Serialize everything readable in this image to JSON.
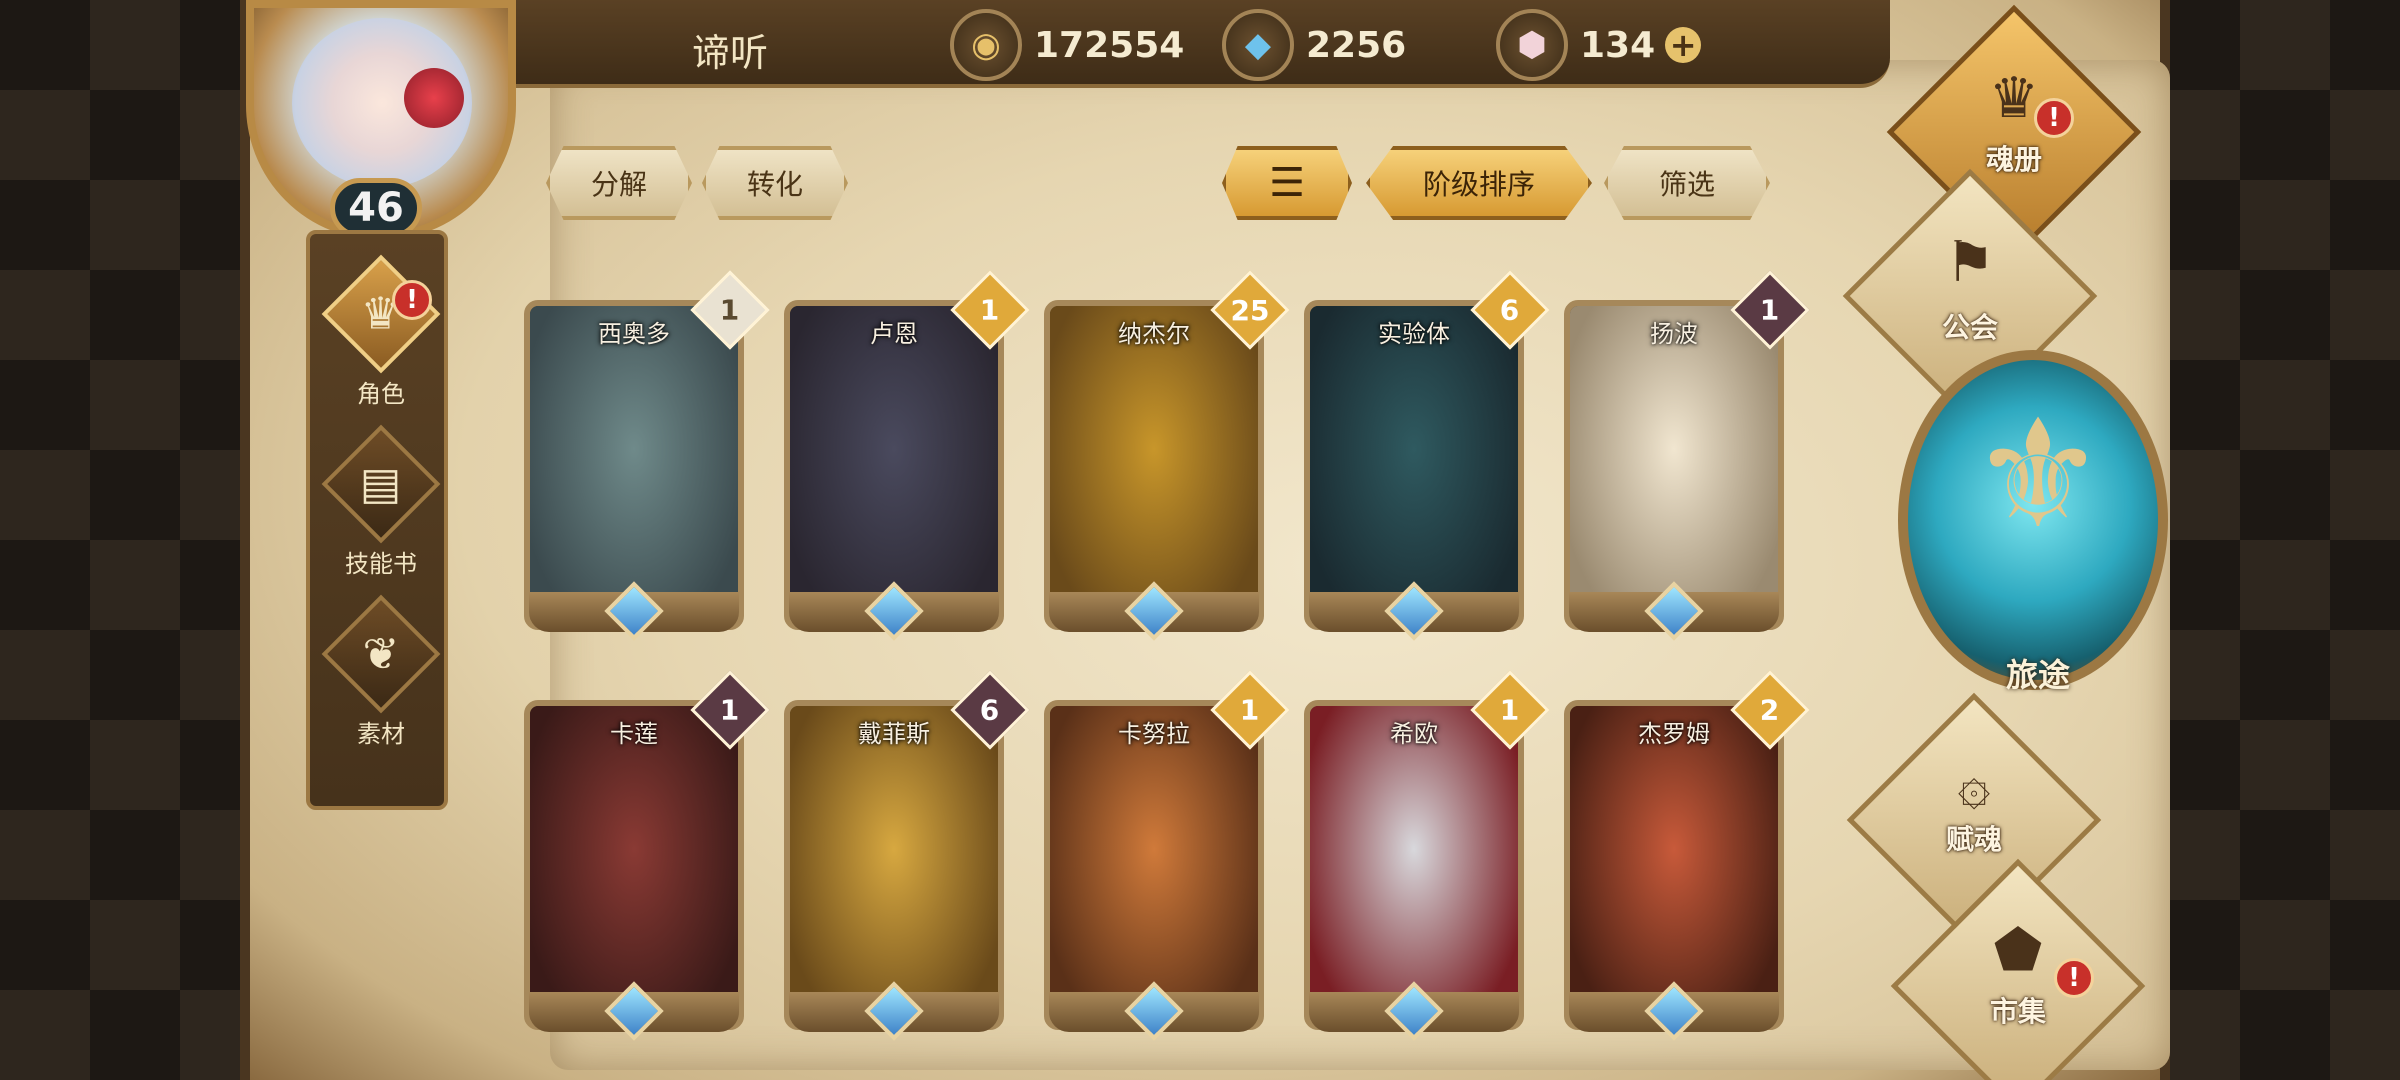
{
  "player": {
    "name": "谛听",
    "level": "46"
  },
  "currencies": [
    {
      "icon": "gold-coin-icon",
      "value": "172554"
    },
    {
      "icon": "blue-crystal-icon",
      "value": "2256"
    },
    {
      "icon": "prism-gem-icon",
      "value": "134"
    }
  ],
  "left_nav": [
    {
      "label": "角色",
      "icon": "character-icon",
      "alert": "!"
    },
    {
      "label": "技能书",
      "icon": "skill-book-icon"
    },
    {
      "label": "素材",
      "icon": "material-icon"
    }
  ],
  "actions": {
    "decompose": "分解",
    "convert": "转化",
    "sort_order": "阶级排序",
    "filter": "筛选",
    "sort_icon": "sort-lines-icon"
  },
  "heroes": [
    {
      "name": "西奥多",
      "count": "1",
      "shard_color": "#e9e2d2"
    },
    {
      "name": "卢恩",
      "count": "1",
      "shard_color": "#e0a93a"
    },
    {
      "name": "纳杰尔",
      "count": "25",
      "shard_color": "#e0a93a"
    },
    {
      "name": "实验体",
      "count": "6",
      "shard_color": "#e0a93a"
    },
    {
      "name": "扬波",
      "count": "1",
      "shard_color": "#5a3a44"
    },
    {
      "name": "卡莲",
      "count": "1",
      "shard_color": "#5a3a44"
    },
    {
      "name": "戴菲斯",
      "count": "6",
      "shard_color": "#5a3a44"
    },
    {
      "name": "卡努拉",
      "count": "1",
      "shard_color": "#e0a93a"
    },
    {
      "name": "希欧",
      "count": "1",
      "shard_color": "#e0a93a"
    },
    {
      "name": "杰罗姆",
      "count": "2",
      "shard_color": "#e0a93a"
    }
  ],
  "right_menu": {
    "soul_book": {
      "label": "魂册",
      "alert": "!"
    },
    "guild": {
      "label": "公会"
    },
    "journey": {
      "label": "旅途"
    },
    "soul_grant": {
      "label": "赋魂"
    },
    "market": {
      "label": "市集",
      "alert": "!"
    }
  },
  "colors": {
    "accent_gold": "#e0a93a",
    "alert_red": "#c8302a",
    "parchment": "#efe3c4"
  }
}
